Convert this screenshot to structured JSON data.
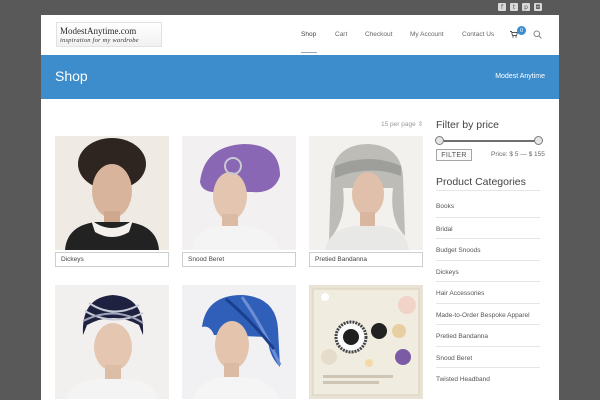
{
  "social_icons": [
    "facebook-icon",
    "twitter-icon",
    "pinterest-icon",
    "instagram-icon"
  ],
  "logo": {
    "line1": "ModestAnytime.com",
    "line2": "inspiration for my wardrobe"
  },
  "nav": {
    "items": [
      "Shop",
      "Cart",
      "Checkout",
      "My Account",
      "Contact Us"
    ],
    "active": "Shop",
    "cart_count": "0"
  },
  "titlebar": {
    "title": "Shop",
    "breadcrumb": "Modest Anytime"
  },
  "catalog": {
    "per_page": "15 per page"
  },
  "products": [
    {
      "label": "Dickeys"
    },
    {
      "label": "Snood Beret"
    },
    {
      "label": "Pretied Bandanna"
    },
    {
      "label": ""
    },
    {
      "label": ""
    },
    {
      "label": ""
    }
  ],
  "filter": {
    "heading": "Filter by price",
    "button": "FILTER",
    "price_text": "Price: $ 5 — $ 155",
    "min": 5,
    "max": 155,
    "range_min": 5,
    "range_max": 155
  },
  "categories": {
    "heading": "Product Categories",
    "items": [
      "Books",
      "Bridal",
      "Budget Snoods",
      "Dickeys",
      "Hair Accessories",
      "Made-to-Order Bespoke Apparel",
      "Pretied Bandanna",
      "Snood Beret",
      "Twisted Headband"
    ]
  },
  "colors": {
    "accent": "#3d8dcc",
    "topbar": "#595959"
  }
}
